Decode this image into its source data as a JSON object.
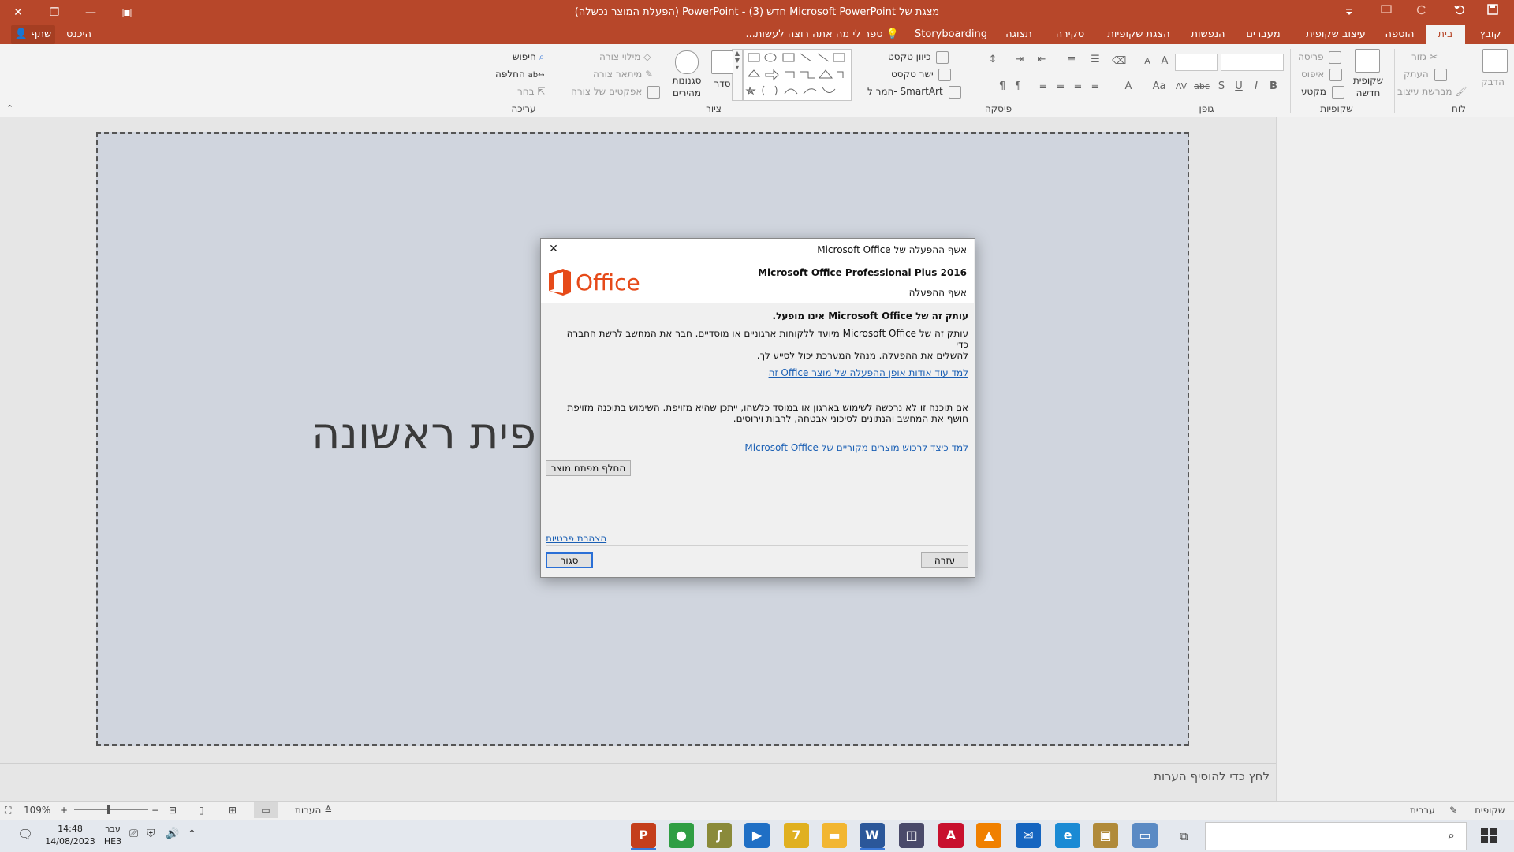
{
  "window": {
    "title": "מצגת של Microsoft PowerPoint חדש (3) - PowerPoint (הפעלת המוצר נכשלה)",
    "controls": {
      "close": "✕",
      "restore": "❐",
      "minimize": "—",
      "ribbon_display": "▣"
    }
  },
  "tabs": {
    "file": "קובץ",
    "home": "בית",
    "insert": "הוספה",
    "design": "עיצוב שקופית",
    "transitions": "מעברים",
    "animations": "הנפשות",
    "slideshow": "הצגת שקופיות",
    "review": "סקירה",
    "view": "תצוגה",
    "storyboarding": "Storyboarding",
    "tell_me": "ספר לי מה אתה רוצה לעשות...",
    "signin": "היכנס",
    "share": "שתף"
  },
  "ribbon": {
    "clipboard": {
      "label": "לוח",
      "paste": "הדבק",
      "cut": "גזור",
      "copy": "העתק",
      "format_painter": "מברשת עיצוב"
    },
    "slides": {
      "label": "שקופיות",
      "new_slide": "שקופית",
      "new_slide_2": "חדשה",
      "layout": "פריסה",
      "reset": "איפוס",
      "section": "מקטע"
    },
    "font": {
      "label": "גופן",
      "bold": "B",
      "italic": "I",
      "underline": "U",
      "shadow": "S",
      "strike": "abc",
      "spacing": "AV",
      "case": "Aa",
      "color": "A",
      "grow": "A",
      "shrink": "A"
    },
    "paragraph": {
      "label": "פיסקה",
      "text_direction": "כיוון טקסט",
      "align_text": "ישר טקסט",
      "smartart": "המר ל- SmartArt"
    },
    "drawing": {
      "label": "ציור",
      "arrange": "סדר",
      "quick_styles": "סגנונות",
      "quick_styles_2": "מהירים",
      "shape_fill": "מילוי צורה",
      "shape_outline": "מיתאר צורה",
      "shape_effects": "אפקטים של צורה"
    },
    "editing": {
      "label": "עריכה",
      "find": "חיפוש",
      "replace": "החלפה",
      "select": "בחר"
    }
  },
  "slide": {
    "title_text": "פית ראשונה"
  },
  "notes": {
    "placeholder": "לחץ כדי להוסיף הערות"
  },
  "statusbar": {
    "slide": "שקופית",
    "language": "עברית",
    "notes": "הערות",
    "zoom": "109%"
  },
  "dialog": {
    "title": "אשף ההפעלה של Microsoft Office",
    "close_glyph": "✕",
    "logo_text": "Office",
    "product": "Microsoft Office Professional Plus 2016",
    "subtitle": "אשף ההפעלה",
    "heading": "עותק זה של Microsoft Office אינו מופעל.",
    "para1_line1": "עותק זה של Microsoft Office מיועד ללקוחות ארגוניים או מוסדיים. חבר את המחשב לרשת החברה כדי",
    "para1_line2": "להשלים את ההפעלה. מנהל המערכת יכול לסייע לך.",
    "link1": "למד עוד אודות אופן ההפעלה של מוצר Office זה",
    "para2_line1": "אם תוכנה זו לא נרכשה לשימוש בארגון או במוסד כלשהו, ייתכן שהיא מזויפת. השימוש בתוכנה מזויפת",
    "para2_line2": "חושף את המחשב והנתונים לסיכוני אבטחה, לרבות וירוסים.",
    "link2": "למד כיצד לרכוש מוצרים מקוריים של Microsoft Office",
    "change_key": "החלף מפתח מוצר",
    "privacy": "הצהרת פרטיות",
    "help": "עזרה",
    "close": "סגור"
  },
  "taskbar": {
    "time": "14:48",
    "date": "14/08/2023",
    "lang_top": "עבר",
    "lang_bottom": "HE3",
    "apps": [
      {
        "name": "PowerPoint",
        "glyph": "P",
        "color": "#c43e1c"
      },
      {
        "name": "Chrome",
        "glyph": "●",
        "color": "#2f9e44"
      },
      {
        "name": "App",
        "glyph": "ʃ",
        "color": "#8a8a3a"
      },
      {
        "name": "Movies",
        "glyph": "▶",
        "color": "#1f6fc5"
      },
      {
        "name": "App2",
        "glyph": "7",
        "color": "#e0b020"
      },
      {
        "name": "Explorer",
        "glyph": "▬",
        "color": "#f2b632"
      },
      {
        "name": "Word",
        "glyph": "W",
        "color": "#2b579a"
      },
      {
        "name": "Reader",
        "glyph": "◫",
        "color": "#4a4a6a"
      },
      {
        "name": "Acrobat",
        "glyph": "A",
        "color": "#c8102e"
      },
      {
        "name": "VLC",
        "glyph": "▲",
        "color": "#f08000"
      },
      {
        "name": "Mail",
        "glyph": "✉",
        "color": "#1565c0"
      },
      {
        "name": "Edge",
        "glyph": "e",
        "color": "#1a8ad4"
      },
      {
        "name": "Photos",
        "glyph": "▣",
        "color": "#b08a3a"
      },
      {
        "name": "Laptop",
        "glyph": "▭",
        "color": "#5a8ac4"
      },
      {
        "name": "Task View",
        "glyph": "⧉",
        "color": "#555"
      }
    ]
  }
}
